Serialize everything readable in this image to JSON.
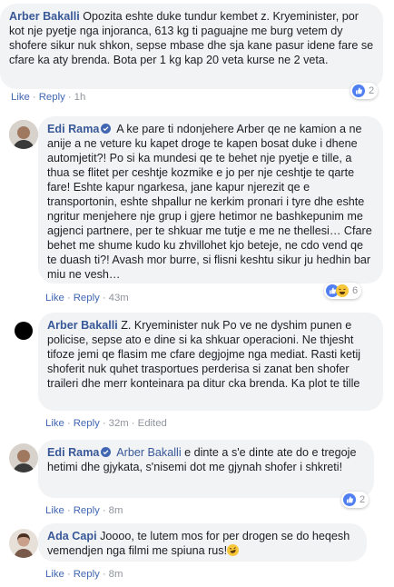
{
  "comments": [
    {
      "author": "Arber Bakalli",
      "text": "Opozita eshte duke tundur kembet z. Kryeminister, por kot nje pyetje nga injoranca, 613 kg ti paguajne me burg vetem dy shofere sikur nuk shkon, sepse mbase dhe sja kane pasur idene fare se cfare ka aty brenda. Bota per 1 kg kap 20 veta kurse ne 2 veta.",
      "like": "Like",
      "reply": "Reply",
      "time": "1h",
      "reaction_count": "2"
    },
    {
      "author": "Edi Rama",
      "text": "A ke pare ti ndonjehere Arber qe ne kamion a ne anije a ne veture ku kapet droge te kapen bosat duke i dhene automjetit?! Po si ka mundesi qe te behet nje pyetje e tille, a thua se flitet per ceshtje kozmike e jo per nje ceshtje te qarte fare! Eshte kapur ngarkesa, jane kapur njerezit qe e transportonin, eshte shpallur ne kerkim pronari i tyre dhe eshte ngritur menjehere nje grup i gjere hetimor ne bashkepunim me agjenci partnere, per te shkuar me tutje e me ne thellesi… Cfare behet me shume kudo ku zhvillohet kjo beteje, ne cdo vend qe te duash ti?! Avash mor burre, si flisni keshtu sikur ju hedhin bar miu ne vesh…",
      "like": "Like",
      "reply": "Reply",
      "time": "43m",
      "reaction_count": "6"
    },
    {
      "author": "Arber Bakalli",
      "text": "Z. Kryeminister nuk Po ve ne dyshim punen e policise, sepse ato e dine si ka shkuar operacioni. Ne thjesht tifoze jemi qe flasim me cfare degjojme nga mediat. Rasti ketij shoferit nuk quhet trasportues perderisa si zanat ben shofer traileri dhe merr konteinara pa ditur cka brenda. Ka plot te tille",
      "like": "Like",
      "reply": "Reply",
      "time": "32m",
      "edited": "Edited"
    },
    {
      "author": "Edi Rama",
      "mention": "Arber Bakalli",
      "text": "e dinte a s'e dinte ate do e tregoje hetimi dhe gjykata, s'nisemi dot me gjynah shofer i shkreti!",
      "like": "Like",
      "reply": "Reply",
      "time": "8m",
      "reaction_count": "2"
    },
    {
      "author": "Ada Capi",
      "text": "Joooo, te lutem mos for per drogen se do heqesh vemendjen nga filmi me spiuna rus!",
      "like": "Like",
      "reply": "Reply",
      "time": "8m"
    }
  ],
  "colors": {
    "link": "#385898",
    "bubble": "#f2f3f5",
    "meta": "#90949c",
    "like_blue": "#4f7ff0",
    "haha_yellow": "#f7c63b"
  }
}
